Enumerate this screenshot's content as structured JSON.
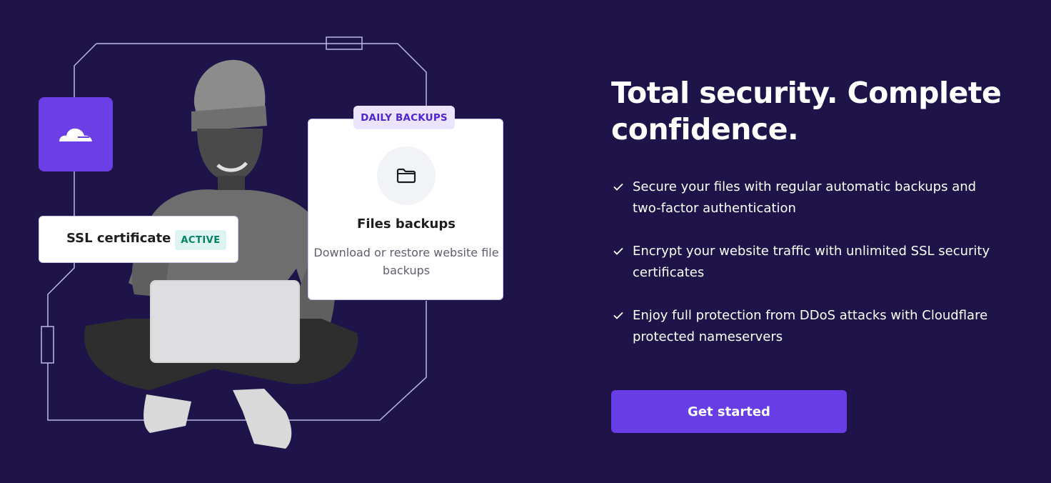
{
  "hero": {
    "headline": "Total security. Complete confidence.",
    "features": [
      "Secure your files with regular automatic backups and two-factor authentication",
      "Encrypt your website traffic with unlimited SSL security certificates",
      "Enjoy full protection from DDoS attacks with Cloudflare protected nameservers"
    ],
    "cta_label": "Get started"
  },
  "ssl_card": {
    "label": "SSL certificate",
    "status": "ACTIVE"
  },
  "backup_card": {
    "badge": "DAILY BACKUPS",
    "title": "Files backups",
    "description": "Download or restore website file backups"
  },
  "icons": {
    "cloud_tile": "cloudflare-icon",
    "folder": "folder-icon",
    "check": "check-icon"
  },
  "colors": {
    "background": "#1f1449",
    "accent": "#673de6",
    "badge_green_bg": "#def4f0",
    "badge_green_text": "#008361",
    "badge_purple_bg": "#ebe4ff",
    "badge_purple_text": "#5025d1"
  }
}
